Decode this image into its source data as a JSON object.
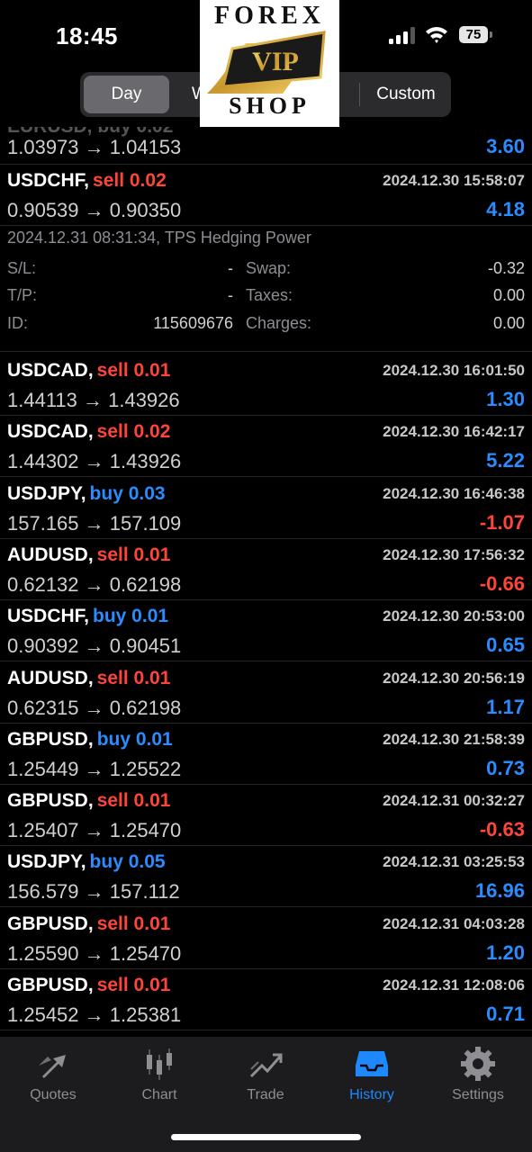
{
  "status": {
    "time": "18:45",
    "battery": "75"
  },
  "segments": {
    "day": "Day",
    "week_partial": "W",
    "custom": "Custom"
  },
  "logo": {
    "top": "FOREX",
    "middle": "VIP",
    "bottom": "SHOP"
  },
  "top_partial_row": {
    "prices": "1.03973 → 1.04153",
    "profit": "3.60"
  },
  "trades": [
    {
      "symbol": "USDCHF,",
      "side": "sell 0.02",
      "type": "sell",
      "date": "2024.12.30 15:58:07",
      "prices": "0.90539 → 0.90350",
      "profit": "4.18"
    },
    {
      "symbol": "USDCAD,",
      "side": "sell 0.01",
      "type": "sell",
      "date": "2024.12.30 16:01:50",
      "prices": "1.44113 → 1.43926",
      "profit": "1.30"
    },
    {
      "symbol": "USDCAD,",
      "side": "sell 0.02",
      "type": "sell",
      "date": "2024.12.30 16:42:17",
      "prices": "1.44302 → 1.43926",
      "profit": "5.22"
    },
    {
      "symbol": "USDJPY,",
      "side": "buy 0.03",
      "type": "buy",
      "date": "2024.12.30 16:46:38",
      "prices": "157.165 → 157.109",
      "profit": "-1.07"
    },
    {
      "symbol": "AUDUSD,",
      "side": "sell 0.01",
      "type": "sell",
      "date": "2024.12.30 17:56:32",
      "prices": "0.62132 → 0.62198",
      "profit": "-0.66"
    },
    {
      "symbol": "USDCHF,",
      "side": "buy 0.01",
      "type": "buy",
      "date": "2024.12.30 20:53:00",
      "prices": "0.90392 → 0.90451",
      "profit": "0.65"
    },
    {
      "symbol": "AUDUSD,",
      "side": "sell 0.01",
      "type": "sell",
      "date": "2024.12.30 20:56:19",
      "prices": "0.62315 → 0.62198",
      "profit": "1.17"
    },
    {
      "symbol": "GBPUSD,",
      "side": "buy 0.01",
      "type": "buy",
      "date": "2024.12.30 21:58:39",
      "prices": "1.25449 → 1.25522",
      "profit": "0.73"
    },
    {
      "symbol": "GBPUSD,",
      "side": "sell 0.01",
      "type": "sell",
      "date": "2024.12.31 00:32:27",
      "prices": "1.25407 → 1.25470",
      "profit": "-0.63"
    },
    {
      "symbol": "USDJPY,",
      "side": "buy 0.05",
      "type": "buy",
      "date": "2024.12.31 03:25:53",
      "prices": "156.579 → 157.112",
      "profit": "16.96"
    },
    {
      "symbol": "GBPUSD,",
      "side": "sell 0.01",
      "type": "sell",
      "date": "2024.12.31 04:03:28",
      "prices": "1.25590 → 1.25470",
      "profit": "1.20"
    },
    {
      "symbol": "GBPUSD,",
      "side": "sell 0.01",
      "type": "sell",
      "date": "2024.12.31 12:08:06",
      "prices": "1.25452 → 1.25381",
      "profit": "0.71"
    }
  ],
  "detail": {
    "comment": "2024.12.31 08:31:34, TPS Hedging Power",
    "sl_label": "S/L:",
    "sl_value": "-",
    "tp_label": "T/P:",
    "tp_value": "-",
    "id_label": "ID:",
    "id_value": "115609676",
    "swap_label": "Swap:",
    "swap_value": "-0.32",
    "taxes_label": "Taxes:",
    "taxes_value": "0.00",
    "charges_label": "Charges:",
    "charges_value": "0.00"
  },
  "tabs": [
    {
      "label": "Quotes",
      "icon": "quotes-arrows-icon",
      "active": false
    },
    {
      "label": "Chart",
      "icon": "candlestick-icon",
      "active": false
    },
    {
      "label": "Trade",
      "icon": "trade-chart-icon",
      "active": false
    },
    {
      "label": "History",
      "icon": "inbox-tray-icon",
      "active": true
    },
    {
      "label": "Settings",
      "icon": "gear-icon",
      "active": false
    }
  ],
  "colors": {
    "buy": "#2a8cff",
    "sell": "#ff453a",
    "active_tab": "#1e88ff"
  }
}
